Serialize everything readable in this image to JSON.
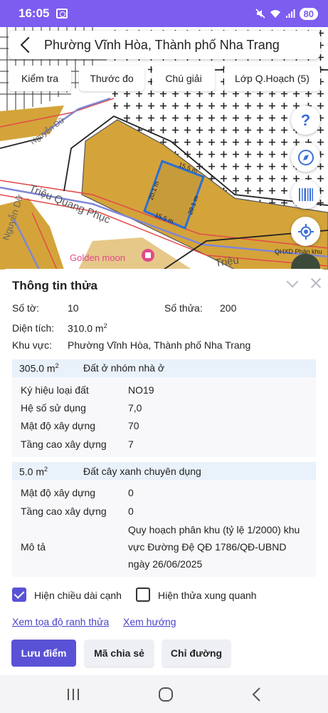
{
  "status": {
    "time": "16:05",
    "battery": "80"
  },
  "header": {
    "location_title": "Phường Vĩnh Hòa, Thành phố Nha Trang"
  },
  "toolbar": {
    "check_label": "Kiểm tra",
    "ruler_label": "Thước đo",
    "legend_label": "Chú giải",
    "layers_label": "Lớp Q.Hoạch (5)"
  },
  "map": {
    "street_1": "Triệu Quang Phục",
    "street_2": "Nguyễn Dữ",
    "street_3": "Nguyễn Dữ",
    "street_4": "Triệu",
    "poi": "Golden moon",
    "edge_top": "15.5 m",
    "edge_bottom": "15.5 m",
    "edge_left": "20.1 m",
    "edge_right": "20.1 m",
    "layer_caption": "QHXD Phân khu",
    "colors": {
      "zone": "#d4a43a",
      "zone_light": "#e6c889",
      "road_red": "#e24a4a",
      "road_blue": "#7f86d6",
      "plot": "#2a6fd6"
    }
  },
  "panel": {
    "title": "Thông tin thửa",
    "sheet_label": "Số tờ:",
    "sheet_value": "10",
    "parcel_label": "Số thửa:",
    "parcel_value": "200",
    "area_label": "Diện tích:",
    "area_value": "310.0 m",
    "area_unit_sup": "2",
    "region_label": "Khu vực:",
    "region_value": "Phường Vĩnh Hòa, Thành phố Nha Trang",
    "sections": [
      {
        "area": "305.0 m",
        "sup": "2",
        "land_type": "Đất ở nhóm nhà ở",
        "rows": [
          {
            "label": "Ký hiệu loại đất",
            "value": "NO19"
          },
          {
            "label": "Hệ số sử dụng",
            "value": "7,0"
          },
          {
            "label": "Mật độ xây dựng",
            "value": "70"
          },
          {
            "label": "Tầng cao xây dựng",
            "value": "7"
          }
        ]
      },
      {
        "area": "5.0 m",
        "sup": "2",
        "land_type": "Đất cây xanh chuyên dụng",
        "rows": [
          {
            "label": "Mật độ xây dựng",
            "value": "0"
          },
          {
            "label": "Tầng cao xây dựng",
            "value": "0"
          }
        ],
        "desc_label": "Mô tả",
        "desc_lines": [
          "Quy hoạch phân khu (tỷ lệ 1/2000) khu",
          "vực Đường Đệ QĐ 1786/QĐ-UBND",
          "ngày 26/06/2025"
        ]
      }
    ],
    "show_edge_length": "Hiện chiều dài cạnh",
    "show_neighbors": "Hiện thửa xung quanh",
    "view_coords_link": "Xem tọa độ ranh thửa",
    "view_direction_link": "Xem hướng",
    "save_point": "Lưu điểm",
    "share_code": "Mã chia sẻ",
    "directions": "Chỉ đường"
  }
}
